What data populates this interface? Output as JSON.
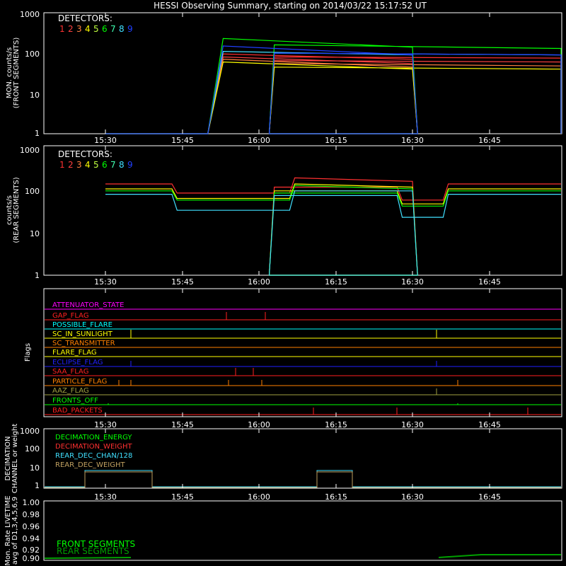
{
  "title": "HESSI Observing Summary, starting on 2014/03/22 15:17:52 UT",
  "x_ticks": [
    "15:30",
    "15:45",
    "16:00",
    "16:15",
    "16:30",
    "16:45"
  ],
  "colors": {
    "det1": "#ff3030",
    "det2": "#ff4040",
    "det3": "#ff8040",
    "det4": "#ffff00",
    "det5": "#c0ff40",
    "det6": "#00ff00",
    "det7": "#40ffb0",
    "det8": "#40e0ff",
    "det9": "#2040ff",
    "magenta": "#ff00ff",
    "red": "#ff2020",
    "cyan": "#00ffff",
    "orange": "#ff8000",
    "yellow": "#ffff00",
    "blue": "#2020ff",
    "green": "#00ff00",
    "olive": "#a0a040",
    "tan": "#c0a060"
  },
  "chart_data": [
    {
      "type": "line",
      "panel": "front",
      "ylabel": "MON. counts/s\n(FRONT SEGMENTS)",
      "ylabel_line1": "MON. counts/s",
      "ylabel_line2": "(FRONT SEGMENTS)",
      "y_ticks": [
        "1",
        "10",
        "100",
        "1000"
      ],
      "ylim": [
        1,
        1000
      ],
      "scale": "log",
      "legend_title": "DETECTORS:",
      "legend_numbers": [
        "1",
        "2",
        "3",
        "4",
        "5",
        "6",
        "7",
        "8",
        "9"
      ],
      "series": [
        {
          "name": "1",
          "color": "#ff3030",
          "x": [
            15.3,
            15.5,
            15.53,
            15.9,
            15.91,
            16.02,
            16.03,
            16.64,
            16.65,
            17.0
          ],
          "y": [
            1,
            1,
            95,
            70,
            1,
            1,
            80,
            75,
            1,
            1
          ]
        },
        {
          "name": "2",
          "color": "#ff4040",
          "x": [
            15.3,
            15.5,
            15.53,
            15.9,
            15.91,
            16.02,
            16.03,
            16.64,
            16.65,
            17.0
          ],
          "y": [
            1,
            1,
            80,
            55,
            1,
            1,
            65,
            60,
            1,
            1
          ]
        },
        {
          "name": "3",
          "color": "#ff8040",
          "x": [
            15.3,
            15.5,
            15.53,
            15.9,
            15.91,
            16.02,
            16.03,
            16.64,
            16.65,
            17.0
          ],
          "y": [
            1,
            1,
            70,
            45,
            1,
            1,
            55,
            48,
            1,
            1
          ]
        },
        {
          "name": "4",
          "color": "#ffff00",
          "x": [
            15.3,
            15.5,
            15.53,
            15.9,
            15.91,
            16.02,
            16.03,
            16.64,
            16.65,
            17.0
          ],
          "y": [
            1,
            1,
            60,
            40,
            1,
            1,
            45,
            40,
            1,
            1
          ]
        },
        {
          "name": "6",
          "color": "#00ff00",
          "x": [
            15.3,
            15.5,
            15.53,
            15.9,
            15.91,
            16.02,
            16.03,
            16.64,
            16.65,
            17.0
          ],
          "y": [
            1,
            1,
            230,
            140,
            1,
            1,
            160,
            130,
            1,
            1
          ]
        },
        {
          "name": "8",
          "color": "#40e0ff",
          "x": [
            15.3,
            15.5,
            15.53,
            15.9,
            15.91,
            16.02,
            16.03,
            16.64,
            16.65,
            17.0
          ],
          "y": [
            1,
            1,
            110,
            90,
            1,
            1,
            100,
            90,
            1,
            1
          ]
        },
        {
          "name": "9",
          "color": "#2040ff",
          "x": [
            15.3,
            15.5,
            15.53,
            15.9,
            15.91,
            16.02,
            16.03,
            16.64,
            16.65,
            17.0
          ],
          "y": [
            1,
            1,
            150,
            90,
            1,
            1,
            100,
            90,
            1,
            1
          ]
        }
      ]
    },
    {
      "type": "line",
      "panel": "rear",
      "ylabel": "counts/s\n(REAR SEGMENTS)",
      "ylabel_line1": "counts/s",
      "ylabel_line2": "(REAR SEGMENTS)",
      "y_ticks": [
        "1",
        "10",
        "100",
        "1000"
      ],
      "ylim": [
        1,
        1000
      ],
      "scale": "log",
      "legend_title": "DETECTORS:",
      "legend_numbers": [
        "1",
        "2",
        "3",
        "4",
        "5",
        "6",
        "7",
        "8",
        "9"
      ],
      "series": [
        {
          "name": "1",
          "color": "#ff3030",
          "x": [
            15.3,
            15.43,
            15.44,
            15.66,
            15.67,
            15.9,
            15.91,
            16.02,
            16.03,
            16.27,
            16.28,
            16.36,
            16.37,
            16.87
          ],
          "y": [
            130,
            130,
            80,
            80,
            180,
            150,
            1,
            1,
            110,
            110,
            55,
            55,
            130,
            130
          ]
        },
        {
          "name": "4",
          "color": "#ffff00",
          "x": [
            15.3,
            15.43,
            15.44,
            15.66,
            15.67,
            15.9,
            15.91,
            16.02,
            16.03,
            16.27,
            16.28,
            16.36,
            16.37,
            16.87
          ],
          "y": [
            100,
            100,
            60,
            60,
            130,
            110,
            1,
            1,
            90,
            90,
            45,
            45,
            100,
            100
          ]
        },
        {
          "name": "6",
          "color": "#00ff00",
          "x": [
            15.3,
            15.43,
            15.44,
            15.66,
            15.67,
            15.9,
            15.91,
            16.02,
            16.03,
            16.27,
            16.28,
            16.36,
            16.37,
            16.87
          ],
          "y": [
            90,
            90,
            55,
            55,
            120,
            100,
            1,
            1,
            80,
            80,
            40,
            40,
            90,
            90
          ]
        },
        {
          "name": "8",
          "color": "#40e0ff",
          "x": [
            15.3,
            15.43,
            15.44,
            15.66,
            15.67,
            15.9,
            15.91,
            16.02,
            16.03,
            16.27,
            16.28,
            16.36,
            16.37,
            16.87
          ],
          "y": [
            75,
            75,
            32,
            32,
            90,
            90,
            1,
            1,
            70,
            70,
            22,
            22,
            75,
            75
          ]
        }
      ]
    }
  ],
  "flags": {
    "ylabel": "Flags",
    "items": [
      {
        "label": "ATTENUATOR_STATE",
        "color": "#ff00ff"
      },
      {
        "label": "GAP_FLAG",
        "color": "#ff2020"
      },
      {
        "label": "POSSIBLE_FLARE",
        "color": "#00ffff"
      },
      {
        "label": "SC_IN_SUNLIGHT",
        "color": "#ffff00"
      },
      {
        "label": "SC_TRANSMITTER",
        "color": "#ff8000"
      },
      {
        "label": "FLARE_FLAG",
        "color": "#ffff00"
      },
      {
        "label": "ECLIPSE_FLAG",
        "color": "#2020ff"
      },
      {
        "label": "SAA_FLAG",
        "color": "#ff2020"
      },
      {
        "label": "PARTICLE_FLAG",
        "color": "#ff8000"
      },
      {
        "label": "AAZ_FLAG",
        "color": "#a0a040"
      },
      {
        "label": "FRONTS_OFF",
        "color": "#00ff00"
      },
      {
        "label": "BAD_PACKETS",
        "color": "#ff2020"
      }
    ]
  },
  "decimation": {
    "ylabel_line1": "DECIMATION",
    "ylabel_line2": "CHANNEL or weight",
    "y_ticks": [
      "1",
      "10",
      "100",
      "1000"
    ],
    "legend": [
      {
        "label": "DECIMATION_ENERGY",
        "color": "#00ff00"
      },
      {
        "label": "DECIMATION_WEIGHT",
        "color": "#ff3030"
      },
      {
        "label": "REAR_DEC_CHAN/128",
        "color": "#40e0ff"
      },
      {
        "label": "REAR_DEC_WEIGHT",
        "color": "#c0a060"
      }
    ]
  },
  "livetime": {
    "ylabel_line1": "Mon. Rate LIVETIME",
    "ylabel_line2": "avg of D1,3,4,5,6,9",
    "y_ticks": [
      "0.90",
      "0.92",
      "0.94",
      "0.96",
      "0.98",
      "1.00"
    ],
    "legend": [
      {
        "label": "FRONT SEGMENTS",
        "color": "#00ff00"
      },
      {
        "label": "REAR SEGMENTS",
        "color": "#00a000"
      }
    ]
  }
}
